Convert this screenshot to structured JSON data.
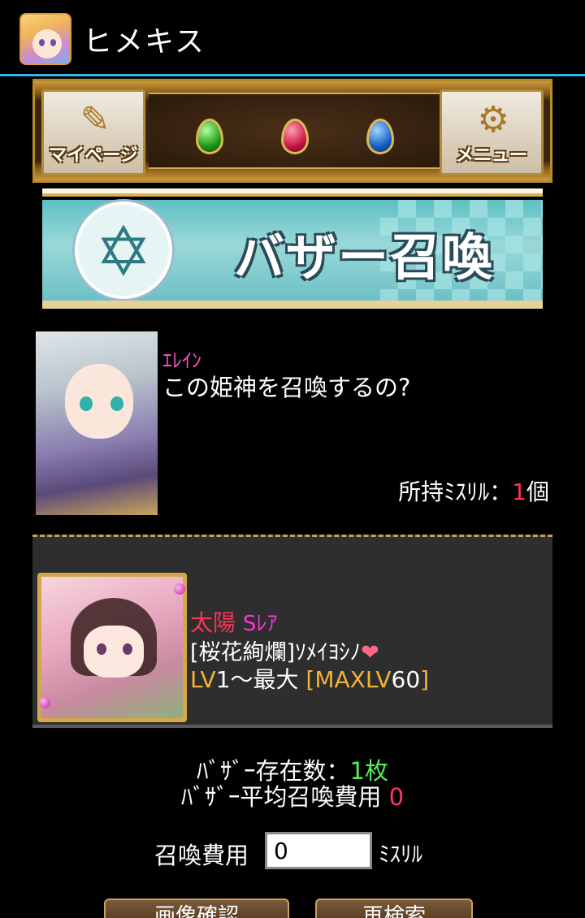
{
  "app": {
    "title": "ヒメキス"
  },
  "nav": {
    "mypage_label": "マイページ",
    "menu_label": "メニュー"
  },
  "banner": {
    "title": "バザー召喚"
  },
  "npc": {
    "name": "ｴﾚｲﾝ",
    "message": "この姫神を召喚するの?"
  },
  "owned": {
    "label": "所持ﾐｽﾘﾙ：",
    "count": "1",
    "unit": "個"
  },
  "card": {
    "attribute": "太陽",
    "rarity": "Sﾚｱ",
    "name": "[桜花絢爛]ｿﾒｲﾖｼﾉ",
    "heart": "❤",
    "lv_prefix": "LV",
    "lv_range": "1～最大",
    "maxlv_open": "[MAXLV",
    "maxlv_value": "60",
    "maxlv_close": "]"
  },
  "stats": {
    "count_label": "ﾊﾞｻﾞｰ存在数：",
    "count_value": "1枚",
    "avg_label": "ﾊﾞｻﾞｰ平均召喚費用",
    "avg_value": "0"
  },
  "cost": {
    "label": "召喚費用",
    "value": "0",
    "unit": "ﾐｽﾘﾙ"
  },
  "buttons": {
    "left_label": "画像確認",
    "right_label": "再検索"
  },
  "colors": {
    "accent_line": "#33b5e5",
    "highlight": "#ff3355",
    "green": "#55ee55",
    "gold": "#f2b234"
  }
}
